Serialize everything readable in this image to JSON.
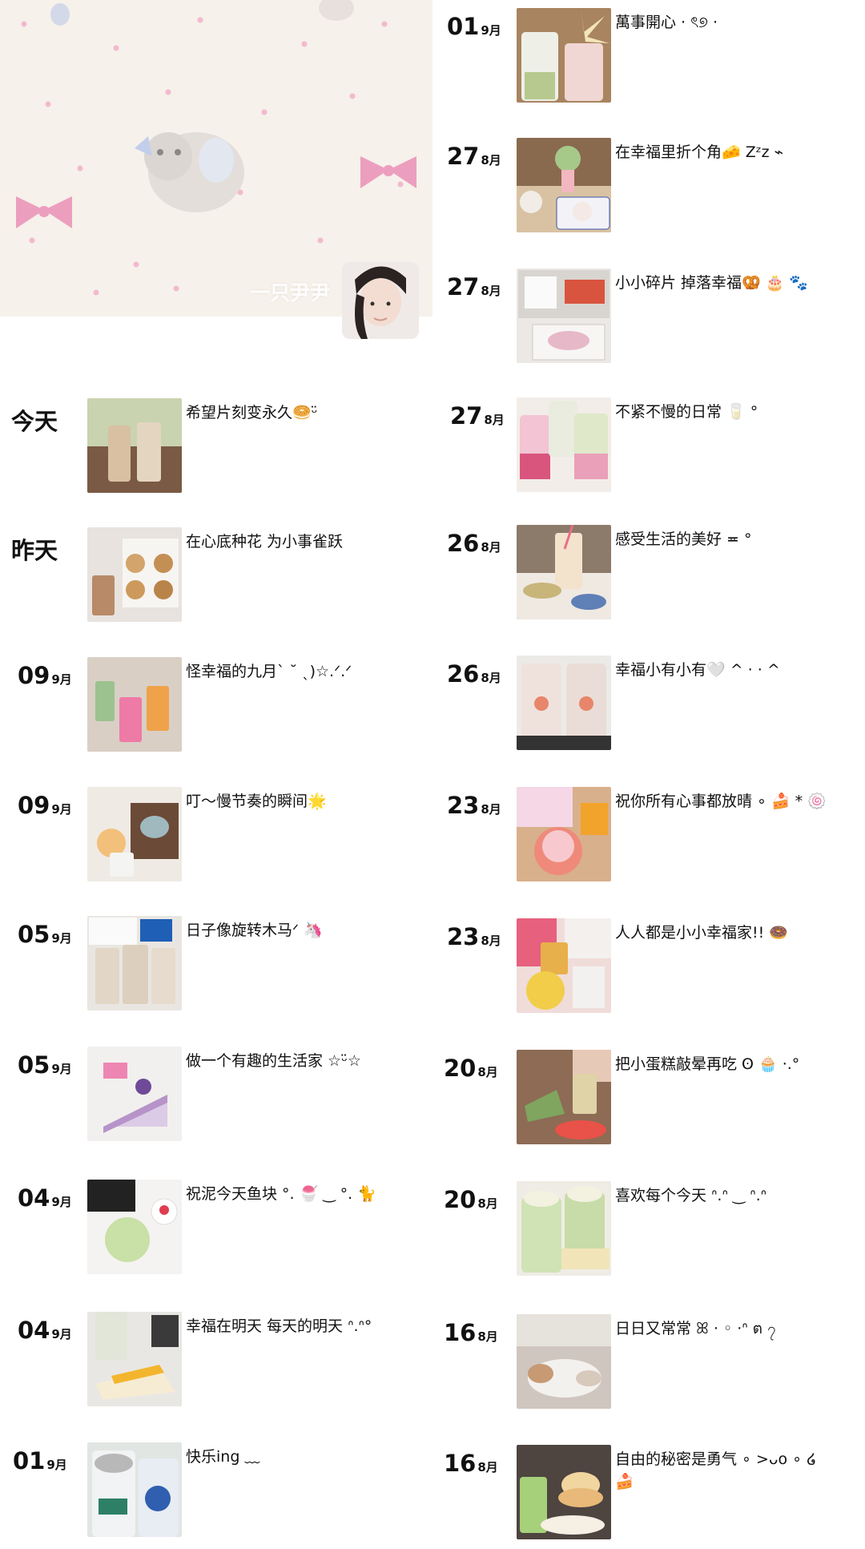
{
  "profile": {
    "name": "一只尹尹"
  },
  "left_entries": [
    {
      "day": "今天",
      "month": "",
      "caption": "希望片刻变永久🥯ᵕ̈"
    },
    {
      "day": "昨天",
      "month": "",
      "caption": "在心底种花 为小事雀跃"
    },
    {
      "day": "09",
      "month": "9月",
      "caption": "怪幸福的九月ˋ ˘ ˎ)☆.ᐟ.ᐟ"
    },
    {
      "day": "09",
      "month": "9月",
      "caption": "叮～慢节奏的瞬间🌟"
    },
    {
      "day": "05",
      "month": "9月",
      "caption": "日子像旋转木马ᐟ 🦄"
    },
    {
      "day": "05",
      "month": "9月",
      "caption": "做一个有趣的生活家 ☆ᵕ̈☆"
    },
    {
      "day": "04",
      "month": "9月",
      "caption": "祝泥今天鱼块 °. 🍧 ‿ °. 🐈"
    },
    {
      "day": "04",
      "month": "9月",
      "caption": "幸福在明天 每天的明天 ᐢ.ᐢ°"
    },
    {
      "day": "01",
      "month": "9月",
      "caption": "快乐ing ﹏"
    }
  ],
  "right_entries": [
    {
      "day": "01",
      "month": "9月",
      "caption": "萬事開心 · ৎ୭ ·"
    },
    {
      "day": "27",
      "month": "8月",
      "caption": "在幸福里折个角🧀 Zᶻz ⌁"
    },
    {
      "day": "27",
      "month": "8月",
      "caption": "小小碎片 掉落幸福🥨 🎂 🐾"
    },
    {
      "day": "27",
      "month": "8月",
      "caption": "不紧不慢的日常 🥛 °"
    },
    {
      "day": "26",
      "month": "8月",
      "caption": "感受生活的美好 ≖ °"
    },
    {
      "day": "26",
      "month": "8月",
      "caption": "幸福小有小有🤍 ^ · · ^"
    },
    {
      "day": "23",
      "month": "8月",
      "caption": "祝你所有心事都放晴 ∘ 🍰 * 🍥"
    },
    {
      "day": "23",
      "month": "8月",
      "caption": "人人都是小小幸福家!! 🍩"
    },
    {
      "day": "20",
      "month": "8月",
      "caption": "把小蛋糕敲晕再吃 ʘ 🧁 ·.°"
    },
    {
      "day": "20",
      "month": "8月",
      "caption": "喜欢每个今天 ᐢ.ᐢ ‿ ᐢ.ᐢ"
    },
    {
      "day": "16",
      "month": "8月",
      "caption": "日日又常常 ꕤ · ◦ ·ᐢ ต ၇"
    },
    {
      "day": "16",
      "month": "8月",
      "caption": "自由的秘密是勇气 ∘ >ᴗo ∘ ໒ 🍰"
    }
  ],
  "colors": {
    "background": "#ffffff",
    "cover": "#f6f1ea",
    "ribbon": "#f2a9c6",
    "text": "#111111"
  }
}
